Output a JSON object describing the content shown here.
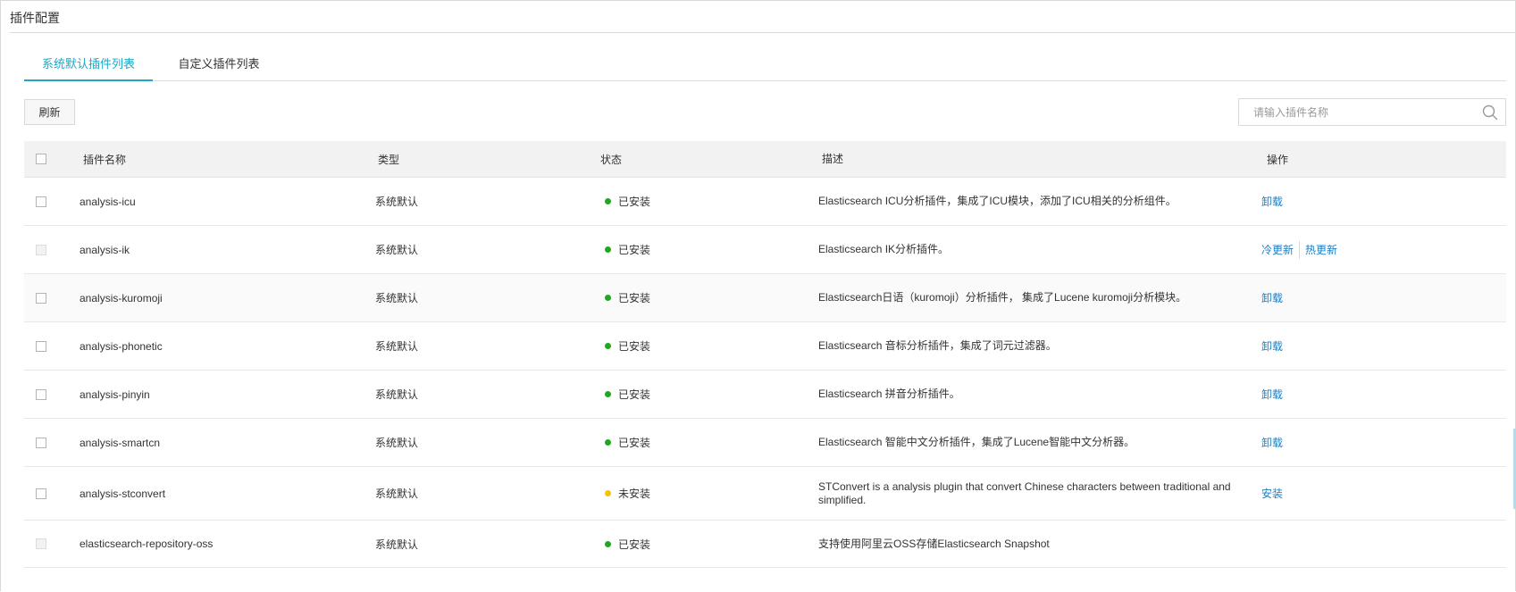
{
  "page": {
    "title": "插件配置"
  },
  "tabs": [
    {
      "label": "系统默认插件列表",
      "active": true
    },
    {
      "label": "自定义插件列表",
      "active": false
    }
  ],
  "toolbar": {
    "refresh_label": "刷新",
    "search_placeholder": "请输入插件名称",
    "search_icon": "search-icon"
  },
  "table": {
    "headers": {
      "name": "插件名称",
      "type": "类型",
      "status": "状态",
      "desc": "描述",
      "ops": "操作"
    },
    "rows": [
      {
        "name": "analysis-icu",
        "type": "系统默认",
        "status": "已安装",
        "status_color": "#1aaa1a",
        "desc": "Elasticsearch ICU分析插件，集成了ICU模块，添加了ICU相关的分析组件。",
        "ops": [
          "卸载"
        ],
        "checkbox_disabled": false
      },
      {
        "name": "analysis-ik",
        "type": "系统默认",
        "status": "已安装",
        "status_color": "#1aaa1a",
        "desc": "Elasticsearch IK分析插件。",
        "ops": [
          "冷更新",
          "热更新"
        ],
        "checkbox_disabled": true
      },
      {
        "name": "analysis-kuromoji",
        "type": "系统默认",
        "status": "已安装",
        "status_color": "#1aaa1a",
        "desc": "Elasticsearch日语（kuromoji）分析插件， 集成了Lucene kuromoji分析模块。",
        "ops": [
          "卸载"
        ],
        "checkbox_disabled": false
      },
      {
        "name": "analysis-phonetic",
        "type": "系统默认",
        "status": "已安装",
        "status_color": "#1aaa1a",
        "desc": "Elasticsearch 音标分析插件，集成了词元过滤器。",
        "ops": [
          "卸载"
        ],
        "checkbox_disabled": false
      },
      {
        "name": "analysis-pinyin",
        "type": "系统默认",
        "status": "已安装",
        "status_color": "#1aaa1a",
        "desc": "Elasticsearch 拼音分析插件。",
        "ops": [
          "卸载"
        ],
        "checkbox_disabled": false
      },
      {
        "name": "analysis-smartcn",
        "type": "系统默认",
        "status": "已安装",
        "status_color": "#1aaa1a",
        "desc": "Elasticsearch 智能中文分析插件，集成了Lucene智能中文分析器。",
        "ops": [
          "卸载"
        ],
        "checkbox_disabled": false
      },
      {
        "name": "analysis-stconvert",
        "type": "系统默认",
        "status": "未安装",
        "status_color": "#f5c400",
        "desc": "STConvert is a analysis plugin that convert Chinese characters between traditional and simplified.",
        "ops": [
          "安装"
        ],
        "checkbox_disabled": false
      },
      {
        "name": "elasticsearch-repository-oss",
        "type": "系统默认",
        "status": "已安装",
        "status_color": "#1aaa1a",
        "desc": "支持使用阿里云OSS存储Elasticsearch Snapshot",
        "ops": [],
        "checkbox_disabled": true
      }
    ]
  },
  "colors": {
    "accent": "#1ba9c8",
    "link": "#1a7ec2",
    "installed": "#1aaa1a",
    "not_installed": "#f5c400"
  }
}
